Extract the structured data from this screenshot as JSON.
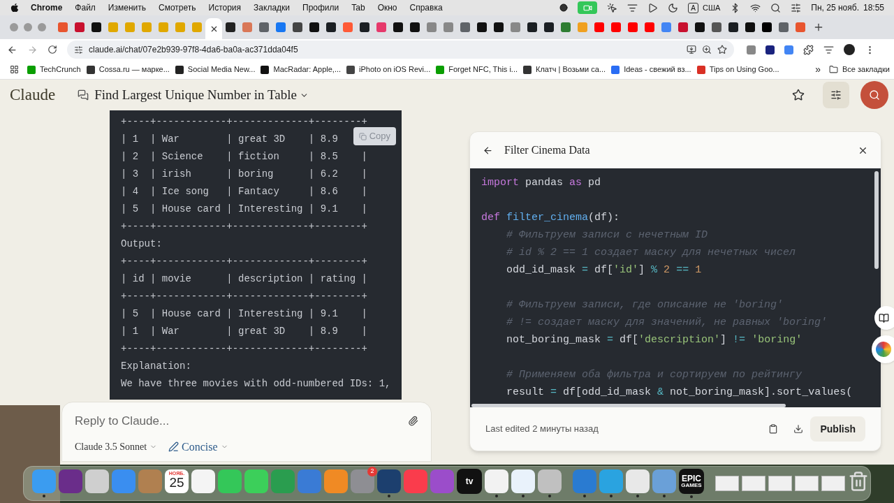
{
  "menu_bar": {
    "app": "Chrome",
    "items": [
      "Файл",
      "Изменить",
      "Смотреть",
      "История",
      "Закладки",
      "Профили",
      "Tab",
      "Окно",
      "Справка"
    ],
    "input_source": "A",
    "layout": "США",
    "date": "Пн, 25 нояб.",
    "time": "18:55"
  },
  "tabs": [
    {
      "color": "#e8552f",
      "selected": false
    },
    {
      "color": "#c8102e",
      "selected": false
    },
    {
      "color": "#111111",
      "selected": false
    },
    {
      "color": "#e0a800",
      "selected": false
    },
    {
      "color": "#e0a800",
      "selected": false
    },
    {
      "color": "#e0a800",
      "selected": false
    },
    {
      "color": "#e0a800",
      "selected": false
    },
    {
      "color": "#e0a800",
      "selected": false
    },
    {
      "color": "#e0a800",
      "selected": false
    },
    {
      "selected": true
    },
    {
      "color": "#222222",
      "selected": false
    },
    {
      "color": "#d97757",
      "selected": false
    },
    {
      "color": "#5f6368",
      "selected": false
    },
    {
      "color": "#1877f2",
      "selected": false
    },
    {
      "color": "#444444",
      "selected": false
    },
    {
      "color": "#111111",
      "selected": false
    },
    {
      "color": "#1b1f23",
      "selected": false
    },
    {
      "color": "#ff5a36",
      "selected": false
    },
    {
      "color": "#1b1f23",
      "selected": false
    },
    {
      "color": "#e6396b",
      "selected": false
    },
    {
      "color": "#111111",
      "selected": false
    },
    {
      "color": "#111111",
      "selected": false
    },
    {
      "color": "#888888",
      "selected": false
    },
    {
      "color": "#888888",
      "selected": false
    },
    {
      "color": "#5f6368",
      "selected": false
    },
    {
      "color": "#111111",
      "selected": false
    },
    {
      "color": "#111111",
      "selected": false
    },
    {
      "color": "#888888",
      "selected": false
    },
    {
      "color": "#1b1f23",
      "selected": false
    },
    {
      "color": "#1b1f23",
      "selected": false
    },
    {
      "color": "#2e7d32",
      "selected": false
    },
    {
      "color": "#f0a020",
      "selected": false
    },
    {
      "color": "#ff0000",
      "selected": false
    },
    {
      "color": "#ff0000",
      "selected": false
    },
    {
      "color": "#ff0000",
      "selected": false
    },
    {
      "color": "#ff0000",
      "selected": false
    },
    {
      "color": "#4285f4",
      "selected": false
    },
    {
      "color": "#c8102e",
      "selected": false
    },
    {
      "color": "#111111",
      "selected": false
    },
    {
      "color": "#555555",
      "selected": false
    },
    {
      "color": "#1b1f23",
      "selected": false
    },
    {
      "color": "#0f0f0f",
      "selected": false
    },
    {
      "color": "#000000",
      "selected": false
    },
    {
      "color": "#5f6368",
      "selected": false
    },
    {
      "color": "#e8552f",
      "selected": false
    }
  ],
  "address_bar": {
    "url": "claude.ai/chat/07e2b939-97f8-4da6-ba0a-ac371dda04f5"
  },
  "bookmarks": {
    "items": [
      {
        "label": "TechCrunch",
        "color": "#0a9e01"
      },
      {
        "label": "Cossa.ru — марке...",
        "color": "#333333"
      },
      {
        "label": "Social Media New...",
        "color": "#222222"
      },
      {
        "label": "MacRadar: Apple,...",
        "color": "#111111"
      },
      {
        "label": "iPhoto on iOS Revi...",
        "color": "#444444"
      },
      {
        "label": "Forget NFC, This i...",
        "color": "#0a9e01"
      },
      {
        "label": "Клатч | Возьми са...",
        "color": "#333333"
      },
      {
        "label": "Ideas - свежий вз...",
        "color": "#2a6df4"
      },
      {
        "label": "Tips on Using Goo...",
        "color": "#d93025"
      }
    ],
    "more": "»",
    "all": "Все закладки"
  },
  "header": {
    "logo": "Claude",
    "chat_title": "Find Largest Unique Number in Table"
  },
  "code_block": {
    "copy": "Copy",
    "lines": [
      "+----+------------+-------------+--------+",
      "| 1  | War        | great 3D    | 8.9",
      "| 2  | Science    | fiction     | 8.5    |",
      "| 3  | irish      | boring      | 6.2    |",
      "| 4  | Ice song   | Fantacy     | 8.6    |",
      "| 5  | House card | Interesting | 9.1    |",
      "+----+------------+-------------+--------+",
      "Output:",
      "+----+------------+-------------+--------+",
      "| id | movie      | description | rating |",
      "+----+------------+-------------+--------+",
      "| 5  | House card | Interesting | 9.1    |",
      "| 1  | War        | great 3D    | 8.9    |",
      "+----+------------+-------------+--------+",
      "Explanation:",
      "We have three movies with odd-numbered IDs: 1,"
    ]
  },
  "composer": {
    "placeholder": "Reply to Claude...",
    "model": "Claude 3.5 Sonnet",
    "style": "Concise"
  },
  "artifact": {
    "title": "Filter Cinema Data",
    "footer": "Last edited 2 минуты назад",
    "publish": "Publish",
    "code": [
      {
        "kind": "code",
        "tokens": [
          {
            "kind": "kw",
            "t": "import"
          },
          {
            "kind": "plain",
            "t": " pandas "
          },
          {
            "kind": "kw",
            "t": "as"
          },
          {
            "kind": "plain",
            "t": " pd"
          }
        ]
      },
      {
        "kind": "blank"
      },
      {
        "kind": "code",
        "tokens": [
          {
            "kind": "kw",
            "t": "def"
          },
          {
            "kind": "fn",
            "t": " filter_cinema"
          },
          {
            "kind": "plain",
            "t": "(df):"
          }
        ]
      },
      {
        "kind": "code",
        "tokens": [
          {
            "kind": "cm",
            "t": "    # Фильтруем записи с нечетным ID"
          }
        ]
      },
      {
        "kind": "code",
        "tokens": [
          {
            "kind": "cm",
            "t": "    # id % 2 == 1 создает маску для нечетных чисел"
          }
        ]
      },
      {
        "kind": "code",
        "tokens": [
          {
            "kind": "plain",
            "t": "    odd_id_mask "
          },
          {
            "kind": "op",
            "t": "="
          },
          {
            "kind": "plain",
            "t": " df["
          },
          {
            "kind": "str",
            "t": "'id'"
          },
          {
            "kind": "plain",
            "t": "] "
          },
          {
            "kind": "op",
            "t": "%"
          },
          {
            "kind": "num",
            "t": " 2"
          },
          {
            "kind": "op",
            "t": " =="
          },
          {
            "kind": "num",
            "t": " 1"
          }
        ]
      },
      {
        "kind": "blank"
      },
      {
        "kind": "code",
        "tokens": [
          {
            "kind": "cm",
            "t": "    # Фильтруем записи, где описание не 'boring'"
          }
        ]
      },
      {
        "kind": "code",
        "tokens": [
          {
            "kind": "cm",
            "t": "    # != создает маску для значений, не равных 'boring'"
          }
        ]
      },
      {
        "kind": "code",
        "tokens": [
          {
            "kind": "plain",
            "t": "    not_boring_mask "
          },
          {
            "kind": "op",
            "t": "="
          },
          {
            "kind": "plain",
            "t": " df["
          },
          {
            "kind": "str",
            "t": "'description'"
          },
          {
            "kind": "plain",
            "t": "] "
          },
          {
            "kind": "op",
            "t": "!="
          },
          {
            "kind": "str",
            "t": " 'boring'"
          }
        ]
      },
      {
        "kind": "blank"
      },
      {
        "kind": "code",
        "tokens": [
          {
            "kind": "cm",
            "t": "    # Применяем оба фильтра и сортируем по рейтингу"
          }
        ]
      },
      {
        "kind": "code",
        "tokens": [
          {
            "kind": "plain",
            "t": "    result "
          },
          {
            "kind": "op",
            "t": "="
          },
          {
            "kind": "plain",
            "t": " df[odd_id_mask "
          },
          {
            "kind": "op",
            "t": "&"
          },
          {
            "kind": "plain",
            "t": " not_boring_mask].sort_values("
          }
        ]
      }
    ]
  },
  "dock": [
    {
      "kind": "app",
      "color": "#3b9cf0",
      "running": true
    },
    {
      "kind": "app",
      "color": "#6a2d8a",
      "running": false
    },
    {
      "kind": "app",
      "color": "#cfcfcf",
      "running": false
    },
    {
      "kind": "app",
      "color": "#3a8ef0",
      "running": false
    },
    {
      "kind": "app",
      "color": "#b08050",
      "running": false
    },
    {
      "kind": "calendar",
      "month": "НОЯБ.",
      "day": "25",
      "running": false
    },
    {
      "kind": "app",
      "color": "#f4f4f4",
      "running": false
    },
    {
      "kind": "app",
      "color": "#34c759",
      "running": false
    },
    {
      "kind": "app",
      "color": "#3ccf5a",
      "running": false
    },
    {
      "kind": "app",
      "color": "#2a9d4f",
      "running": false
    },
    {
      "kind": "app",
      "color": "#3a7bd5",
      "running": false
    },
    {
      "kind": "app",
      "color": "#f08a24",
      "running": false
    },
    {
      "kind": "app",
      "color": "#8e8e93",
      "running": false,
      "badge": "2"
    },
    {
      "kind": "app",
      "color": "#1c3f6e",
      "running": true
    },
    {
      "kind": "app",
      "color": "#fa3c4c",
      "running": false
    },
    {
      "kind": "app",
      "color": "#9b4dca",
      "running": false
    },
    {
      "kind": "label",
      "lines": [
        "tv"
      ],
      "running": false
    },
    {
      "kind": "app",
      "color": "#f2f2f2",
      "running": true
    },
    {
      "kind": "app",
      "color": "#e9f2fb",
      "running": true
    },
    {
      "kind": "app",
      "color": "#c0c0c0",
      "running": true
    },
    {
      "kind": "separator"
    },
    {
      "kind": "app",
      "color": "#2a7bd1",
      "running": true
    },
    {
      "kind": "app",
      "color": "#2aa3e0",
      "running": true
    },
    {
      "kind": "app",
      "color": "#e8e8e8",
      "running": true
    },
    {
      "kind": "app",
      "color": "#6aa0d8",
      "running": true
    },
    {
      "kind": "label",
      "lines": [
        "EPIC",
        "GAMES"
      ],
      "running": true
    },
    {
      "kind": "separator"
    },
    {
      "kind": "window"
    },
    {
      "kind": "window"
    },
    {
      "kind": "window"
    },
    {
      "kind": "window"
    },
    {
      "kind": "window"
    },
    {
      "kind": "trash"
    }
  ]
}
